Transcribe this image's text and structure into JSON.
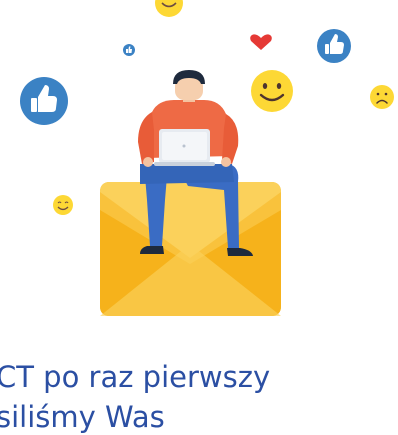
{
  "hero": {
    "headline_line1": "CT po raz pierwszy",
    "headline_line2": "siliśmy Was"
  },
  "colors": {
    "envelope": "#fbc02d",
    "envelope_flap": "#f9d56e",
    "like_badge": "#3b82c4",
    "heart": "#e53935",
    "smiley": "#fdd835",
    "headline": "#2b4fa3"
  },
  "icons": [
    "thumbs-up-icon",
    "heart-icon",
    "smiley-icon",
    "sad-face-icon",
    "laptop-icon",
    "envelope-icon"
  ]
}
